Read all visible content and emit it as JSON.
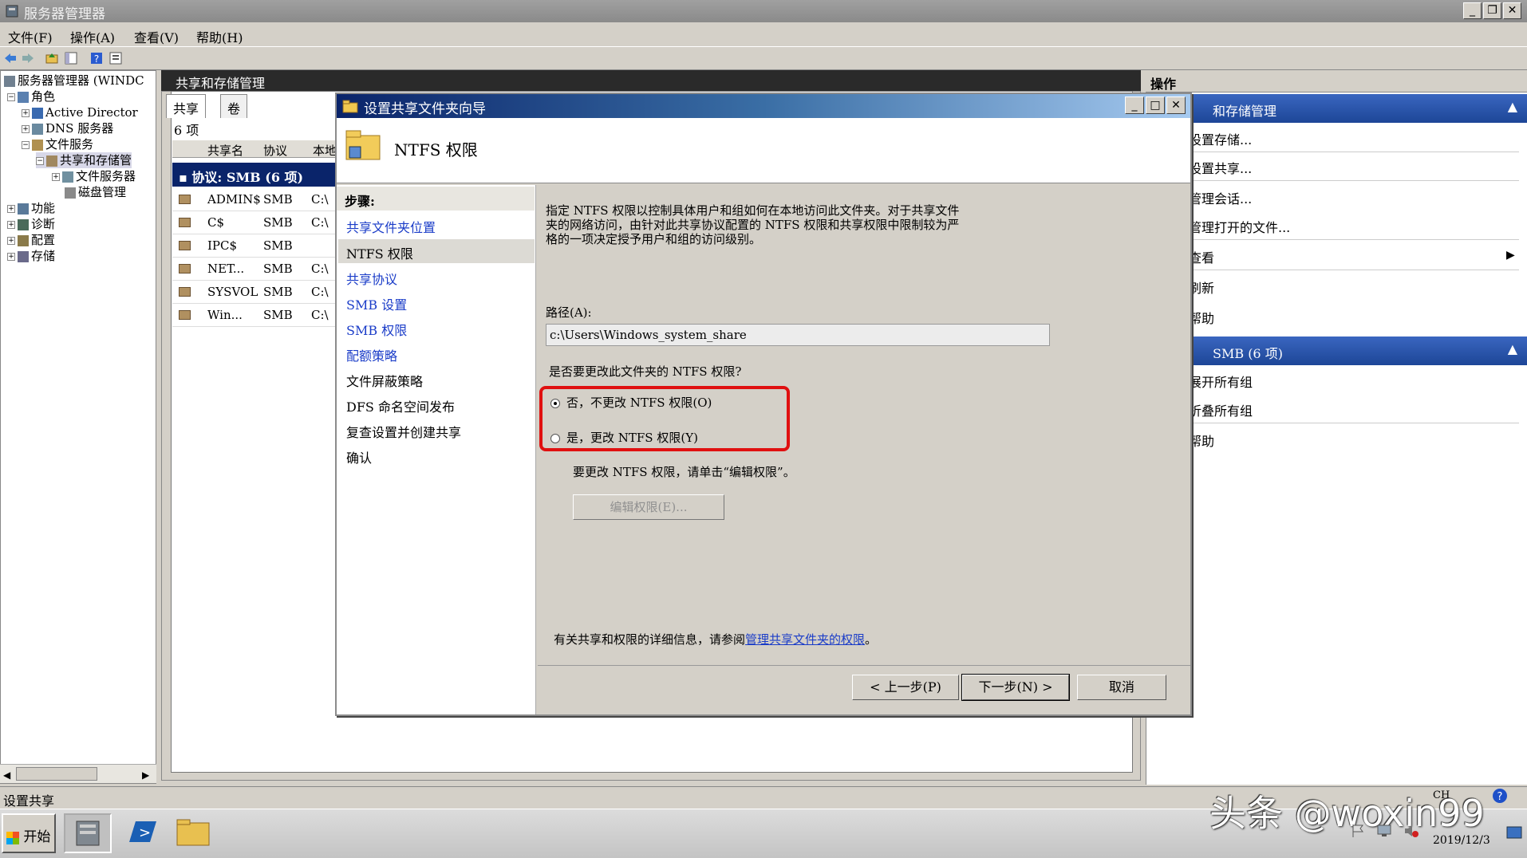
{
  "window": {
    "title": "服务器管理器"
  },
  "menu": [
    "文件(F)",
    "操作(A)",
    "查看(V)",
    "帮助(H)"
  ],
  "tree": {
    "root": "服务器管理器 (WINDC",
    "roles": "角色",
    "ad": "Active Director",
    "dns": "DNS 服务器",
    "fileservices": "文件服务",
    "share_storage": "共享和存储管",
    "fileserver": "文件服务器",
    "disk": "磁盘管理",
    "features": "功能",
    "diagnostics": "诊断",
    "config": "配置",
    "storage": "存储"
  },
  "center": {
    "header": "共享和存储管理",
    "tab_share": "共享",
    "tab_volume": "卷",
    "count": "6 项",
    "col_name": "共享名",
    "col_protocol": "协议",
    "col_local": "本地",
    "group": "协议: SMB (6 项)",
    "rows": [
      {
        "name": "ADMIN$",
        "protocol": "SMB",
        "path": "C:\\"
      },
      {
        "name": "C$",
        "protocol": "SMB",
        "path": "C:\\"
      },
      {
        "name": "IPC$",
        "protocol": "SMB",
        "path": ""
      },
      {
        "name": "NET...",
        "protocol": "SMB",
        "path": "C:\\"
      },
      {
        "name": "SYSVOL",
        "protocol": "SMB",
        "path": "C:\\"
      },
      {
        "name": "Win...",
        "protocol": "SMB",
        "path": "C:\\"
      }
    ]
  },
  "actions": {
    "header": "操作",
    "section1": "和存储管理",
    "items1": [
      "设置存储...",
      "设置共享...",
      "管理会话...",
      "管理打开的文件...",
      "查看",
      "刷新",
      "帮助"
    ],
    "section2": "SMB (6 项)",
    "items2": [
      "展开所有组",
      "折叠所有组",
      "帮助"
    ]
  },
  "dialog": {
    "title": "设置共享文件夹向导",
    "heading": "NTFS 权限",
    "steps_label": "步骤:",
    "steps": [
      "共享文件夹位置",
      "NTFS 权限",
      "共享协议",
      "SMB 设置",
      "SMB 权限",
      "配额策略",
      "文件屏蔽策略",
      "DFS 命名空间发布",
      "复查设置并创建共享",
      "确认"
    ],
    "desc1": "指定 NTFS 权限以控制具体用户和组如何在本地访问此文件夹。对于共享文件",
    "desc2": "夹的网络访问，由针对此共享协议配置的 NTFS 权限和共享权限中限制较为严",
    "desc3": "格的一项决定授予用户和组的访问级别。",
    "path_label": "路径(A):",
    "path_value": "c:\\Users\\Windows_system_share",
    "question": "是否要更改此文件夹的 NTFS 权限?",
    "opt_no": "否，不更改 NTFS 权限(O)",
    "opt_yes": "是，更改 NTFS 权限(Y)",
    "hint": "要更改 NTFS 权限，请单击“编辑权限”。",
    "edit_btn": "编辑权限(E)...",
    "info_prefix": "有关共享和权限的详细信息，请参阅",
    "info_link": "管理共享文件夹的权限",
    "info_suffix": "。",
    "back_btn": "< 上一步(P)",
    "next_btn": "下一步(N) >",
    "cancel_btn": "取消"
  },
  "status": {
    "text": "设置共享"
  },
  "taskbar": {
    "start": "开始"
  },
  "tray": {
    "lang": "CH",
    "date": "2019/12/3"
  },
  "watermark": "头条 @woxin99",
  "colors": {
    "highlight": "#e01010",
    "accent": "#0a246a",
    "link": "#1a3cc8"
  }
}
